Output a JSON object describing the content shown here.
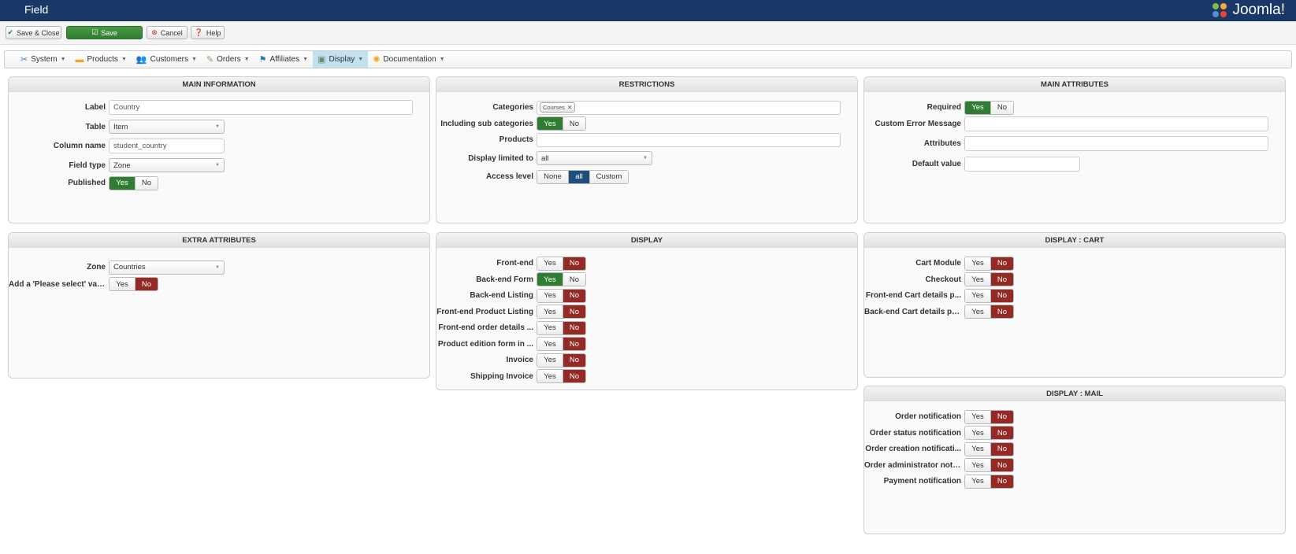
{
  "header": {
    "title": "Field",
    "logo_text": "Joomla!"
  },
  "toolbar": {
    "save_close": "Save & Close",
    "save": "Save",
    "cancel": "Cancel",
    "help": "Help"
  },
  "menu": [
    {
      "label": "System",
      "icon": "tools-icon"
    },
    {
      "label": "Products",
      "icon": "box-icon"
    },
    {
      "label": "Customers",
      "icon": "users-icon"
    },
    {
      "label": "Orders",
      "icon": "orders-icon"
    },
    {
      "label": "Affiliates",
      "icon": "affiliates-icon"
    },
    {
      "label": "Display",
      "icon": "display-icon",
      "active": true
    },
    {
      "label": "Documentation",
      "icon": "lifebuoy-icon"
    }
  ],
  "main_information": {
    "title": "MAIN INFORMATION",
    "label_label": "Label",
    "label_value": "Country",
    "table_label": "Table",
    "table_value": "Item",
    "column_label": "Column name",
    "column_value": "student_country",
    "fieldtype_label": "Field type",
    "fieldtype_value": "Zone",
    "published_label": "Published",
    "published": "Yes"
  },
  "restrictions": {
    "title": "RESTRICTIONS",
    "categories_label": "Categories",
    "categories_tag": "Courses",
    "subcat_label": "Including sub categories",
    "subcat": "Yes",
    "products_label": "Products",
    "products_value": "",
    "limited_label": "Display limited to",
    "limited_value": "all",
    "access_label": "Access level",
    "access_options": [
      "None",
      "all",
      "Custom"
    ],
    "access_selected": "all"
  },
  "main_attributes": {
    "title": "MAIN ATTRIBUTES",
    "required_label": "Required",
    "required": "Yes",
    "error_label": "Custom Error Message",
    "error_value": "",
    "attributes_label": "Attributes",
    "attributes_value": "",
    "default_label": "Default value",
    "default_value": ""
  },
  "extra_attributes": {
    "title": "EXTRA ATTRIBUTES",
    "zone_label": "Zone",
    "zone_value": "Countries",
    "please_label": "Add a 'Please select' value",
    "please": "No"
  },
  "toggle": {
    "yes": "Yes",
    "no": "No"
  },
  "display": {
    "title": "DISPLAY",
    "items": [
      {
        "label": "Front-end",
        "value": "No"
      },
      {
        "label": "Back-end Form",
        "value": "Yes"
      },
      {
        "label": "Back-end Listing",
        "value": "No"
      },
      {
        "label": "Front-end Product Listing",
        "value": "No"
      },
      {
        "label": "Front-end order details ...",
        "value": "No"
      },
      {
        "label": "Product edition form in ...",
        "value": "No"
      },
      {
        "label": "Invoice",
        "value": "No"
      },
      {
        "label": "Shipping Invoice",
        "value": "No"
      }
    ]
  },
  "display_cart": {
    "title": "DISPLAY : CART",
    "items": [
      {
        "label": "Cart Module",
        "value": "No"
      },
      {
        "label": "Checkout",
        "value": "No"
      },
      {
        "label": "Front-end Cart details p...",
        "value": "No"
      },
      {
        "label": "Back-end Cart details pa...",
        "value": "No"
      }
    ]
  },
  "display_mail": {
    "title": "DISPLAY : MAIL",
    "items": [
      {
        "label": "Order notification",
        "value": "No"
      },
      {
        "label": "Order status notification",
        "value": "No"
      },
      {
        "label": "Order creation notificati...",
        "value": "No"
      },
      {
        "label": "Order administrator noti...",
        "value": "No"
      },
      {
        "label": "Payment notification",
        "value": "No"
      }
    ]
  }
}
